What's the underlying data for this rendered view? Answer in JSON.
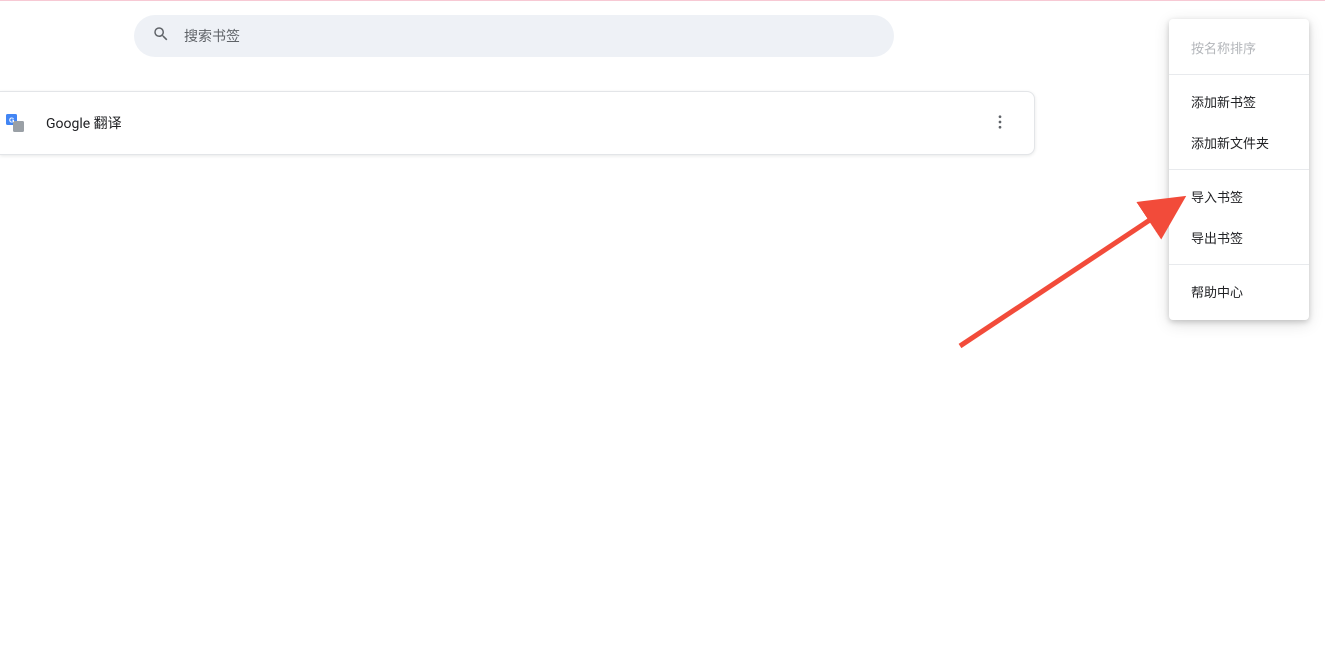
{
  "search": {
    "placeholder": "搜索书签"
  },
  "bookmark": {
    "title": "Google 翻译"
  },
  "menu": {
    "sort_by_name": "按名称排序",
    "add_bookmark": "添加新书签",
    "add_folder": "添加新文件夹",
    "import_bookmarks": "导入书签",
    "export_bookmarks": "导出书签",
    "help_center": "帮助中心"
  }
}
